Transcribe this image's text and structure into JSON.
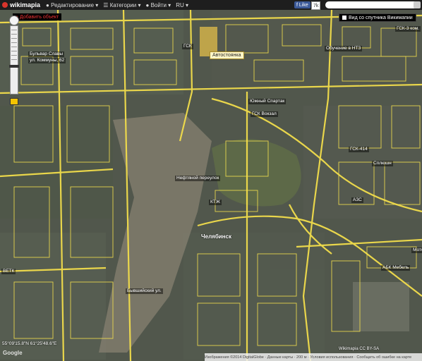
{
  "topbar": {
    "logo": "wikimapia",
    "menu_edit": "Редактирование",
    "menu_categories": "Категории",
    "menu_login": "Войти",
    "language": "RU",
    "like_label": "Like",
    "like_count": "7k",
    "search_placeholder": ""
  },
  "controls": {
    "add_object": "Добавить объект",
    "satellite_view": "Вид со спутника Викимапии"
  },
  "map": {
    "city_label": "Челябинск",
    "popup_label": "Автостоянка",
    "place_labels": [
      "Бульвар Славы",
      "ул. Коммуны, 62",
      "Южный Спартак",
      "ГСК Вокзал",
      "Нефтяной переулок",
      "КТЖ",
      "ГСК-414",
      "Сплюшн",
      "АЗС",
      "ВЕТК",
      "Бывшийский ул.",
      "Мотор",
      "АБК Мебель",
      "ГСК",
      "Обучение в НТЗ",
      "ГСК-3 ком."
    ],
    "coordinates": "55°09'15.8\"N 61°25'48.6\"E",
    "google": "Google",
    "wikimapia_credit": "Wikimapia CC BY-SA",
    "attribution": "Изображения ©2014 DigitalGlobe · Данные карты · 200 м · Условия использования · Сообщить об ошибке на карте"
  },
  "colors": {
    "road": "#f2dd4b",
    "building_outline": "#f4e04d",
    "topbar": "#1e1e1e",
    "popup_bg": "#fff7c8"
  }
}
